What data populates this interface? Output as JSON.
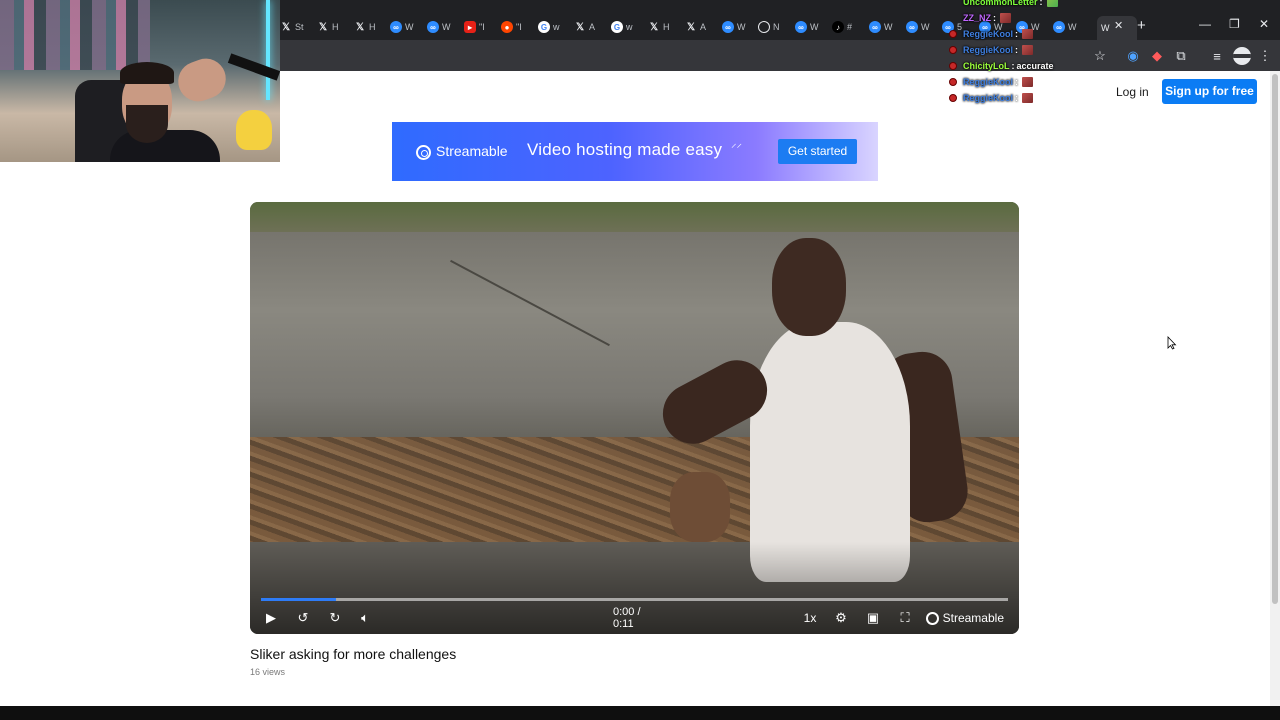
{
  "tabs": [
    {
      "label": "St",
      "icon": "x-icon",
      "kind": "sx"
    },
    {
      "label": "H",
      "icon": "x-icon",
      "kind": "sx"
    },
    {
      "label": "H",
      "icon": "x-icon",
      "kind": "sx"
    },
    {
      "label": "W",
      "icon": "streamable-icon",
      "kind": "ss"
    },
    {
      "label": "W",
      "icon": "streamable-icon",
      "kind": "ss"
    },
    {
      "label": "\"I",
      "icon": "youtube-icon",
      "kind": "yt"
    },
    {
      "label": "\"I",
      "icon": "reddit-icon",
      "kind": "rd"
    },
    {
      "label": "w",
      "icon": "google-icon",
      "kind": "gg"
    },
    {
      "label": "A",
      "icon": "x-icon",
      "kind": "sx"
    },
    {
      "label": "w",
      "icon": "google-icon",
      "kind": "gg"
    },
    {
      "label": "H",
      "icon": "x-icon",
      "kind": "sx"
    },
    {
      "label": "A",
      "icon": "x-icon",
      "kind": "sx"
    },
    {
      "label": "W",
      "icon": "streamable-icon",
      "kind": "ss"
    },
    {
      "label": "N",
      "icon": "link-icon",
      "kind": "nn"
    },
    {
      "label": "W",
      "icon": "streamable-icon",
      "kind": "ss"
    },
    {
      "label": "#",
      "icon": "tiktok-icon",
      "kind": "tt"
    },
    {
      "label": "W",
      "icon": "streamable-icon",
      "kind": "ss"
    },
    {
      "label": "W",
      "icon": "streamable-icon",
      "kind": "ss"
    },
    {
      "label": "5",
      "icon": "streamable-icon",
      "kind": "ss"
    },
    {
      "label": "W",
      "icon": "streamable-icon",
      "kind": "ss"
    },
    {
      "label": "W",
      "icon": "streamable-icon",
      "kind": "ss"
    },
    {
      "label": "W",
      "icon": "streamable-icon",
      "kind": "ss"
    }
  ],
  "active_tab": {
    "label": "W"
  },
  "header": {
    "login": "Log in",
    "signup": "Sign up for free"
  },
  "banner": {
    "brand": "Streamable",
    "tagline": "Video hosting made easy",
    "cta": "Get started"
  },
  "player": {
    "time": "0:00 / 0:11",
    "speed": "1x",
    "brand": "Streamable",
    "progress_fraction": 0.1
  },
  "video": {
    "title": "Sliker asking for more challenges",
    "views": "16 views"
  },
  "chat": [
    {
      "user": "UncommonLetter",
      "sep": ":",
      "msg": "",
      "color": "#7fff3b",
      "emote": "green",
      "badge": false
    },
    {
      "user": "ZZ_NZ",
      "sep": ":",
      "msg": "",
      "color": "#c066ff",
      "emote": "red",
      "badge": false
    },
    {
      "user": "ReggieKool",
      "sep": ":",
      "msg": "",
      "color": "#3f7fe0",
      "emote": "red",
      "badge": true
    },
    {
      "user": "ReggieKool",
      "sep": ":",
      "msg": "",
      "color": "#3f7fe0",
      "emote": "red",
      "badge": true
    },
    {
      "user": "ChicityLoL",
      "sep": ":",
      "msg": "accurate",
      "color": "#9cff3b",
      "emote": "",
      "badge": true
    },
    {
      "user": "ReggieKool",
      "sep": ":",
      "msg": "",
      "color": "#3f7fe0",
      "emote": "red",
      "badge": true
    },
    {
      "user": "ReggieKool",
      "sep": ":",
      "msg": "",
      "color": "#3f7fe0",
      "emote": "red",
      "badge": true
    }
  ],
  "colors": {
    "accent": "#0b7cf4",
    "progress": "#2e7cf6"
  }
}
